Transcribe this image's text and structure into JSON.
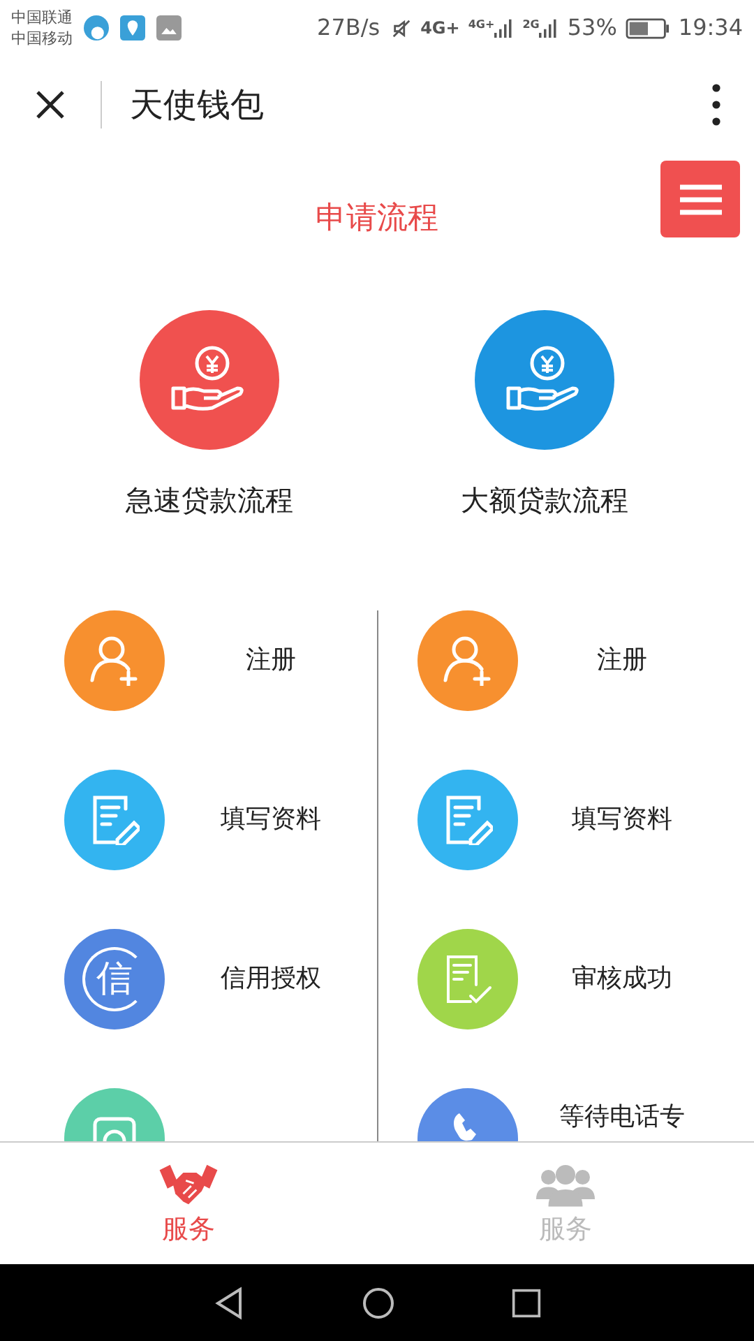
{
  "status_bar": {
    "carriers": [
      "中国联通",
      "中国移动"
    ],
    "speed": "27B/s",
    "networks": [
      "4G+",
      "4G+",
      "2G"
    ],
    "battery_text": "53%",
    "time": "19:34"
  },
  "header": {
    "title": "天使钱包"
  },
  "section_title": "申请流程",
  "loan_types": [
    {
      "label": "急速贷款流程",
      "color": "#f0514f"
    },
    {
      "label": "大额贷款流程",
      "color": "#1d95e0"
    }
  ],
  "step_columns": [
    [
      {
        "label": "注册",
        "kind": "user-add",
        "color": "#f7902f"
      },
      {
        "label": "填写资料",
        "kind": "form",
        "color": "#33b4f0"
      },
      {
        "label": "信用授权",
        "kind": "credit",
        "icon_text": "信",
        "color": "#5286e0"
      },
      {
        "kind": "camera",
        "color": "#5ccfa8"
      }
    ],
    [
      {
        "label": "注册",
        "kind": "user-add",
        "color": "#f7902f"
      },
      {
        "label": "填写资料",
        "kind": "form",
        "color": "#33b4f0"
      },
      {
        "label": "审核成功",
        "kind": "check-doc",
        "color": "#a0d64a"
      },
      {
        "label": "等待电话专",
        "kind": "phone",
        "color": "#5b8de6"
      }
    ]
  ],
  "tabs": [
    {
      "label": "服务",
      "kind": "handshake",
      "selected": true
    },
    {
      "label": "服务",
      "kind": "people",
      "selected": false
    }
  ]
}
